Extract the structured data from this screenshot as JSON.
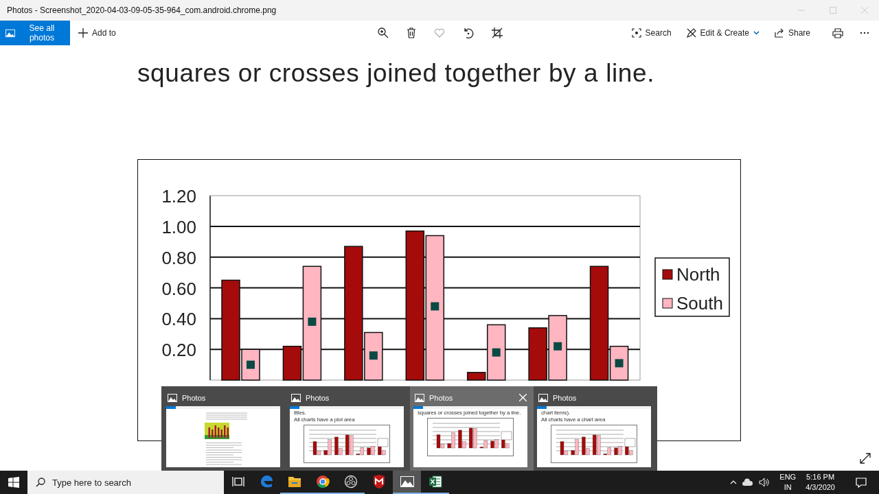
{
  "window": {
    "title": "Photos - Screenshot_2020-04-03-09-05-35-964_com.android.chrome.png"
  },
  "toolbar": {
    "see_all_photos": "See all photos",
    "add_to": "Add to",
    "favorite": false,
    "search": "Search",
    "edit_create": "Edit & Create",
    "share": "Share"
  },
  "image": {
    "heading": "squares or crosses joined together by a line.",
    "chart_data": {
      "type": "bar",
      "grid": true,
      "legend": "right",
      "ylim": [
        0,
        1.2
      ],
      "yticks": [
        {
          "value": 0.2,
          "label": "0.20"
        },
        {
          "value": 0.4,
          "label": "0.40"
        },
        {
          "value": 0.6,
          "label": "0.60"
        },
        {
          "value": 0.8,
          "label": "0.80"
        },
        {
          "value": 1.0,
          "label": "1.00"
        },
        {
          "value": 1.2,
          "label": "1.20"
        }
      ],
      "series": [
        {
          "name": "North",
          "color": "#a50b0b",
          "values": [
            0.65,
            0.22,
            0.87,
            0.97,
            0.05,
            0.34,
            0.74
          ]
        },
        {
          "name": "South",
          "color": "#ffb6c1",
          "values": [
            0.2,
            0.74,
            0.31,
            0.94,
            0.36,
            0.42,
            0.22
          ]
        },
        {
          "type": "scatter",
          "color": "#0a4a44",
          "values": [
            0.1,
            0.38,
            0.16,
            0.48,
            0.18,
            0.22,
            0.11
          ]
        }
      ]
    }
  },
  "task_previews": [
    {
      "title": "Photos",
      "selected": false,
      "kind": "document"
    },
    {
      "title": "Photos",
      "selected": false,
      "kind": "chart",
      "texts": [
        "titles.",
        "All charts have a plot area"
      ]
    },
    {
      "title": "Photos",
      "selected": true,
      "kind": "chart",
      "texts": [
        "squares or crosses joined together by a line."
      ]
    },
    {
      "title": "Photos",
      "selected": false,
      "kind": "chart",
      "texts": [
        "chart items).",
        "All charts have a chart area"
      ]
    }
  ],
  "taskbar": {
    "search_placeholder": "Type here to search",
    "apps": [
      {
        "kind": "taskview",
        "open": false,
        "selected": false
      },
      {
        "kind": "edge",
        "open": false,
        "selected": false
      },
      {
        "kind": "explorer",
        "open": true,
        "selected": false
      },
      {
        "kind": "chrome",
        "open": true,
        "selected": false
      },
      {
        "kind": "obs",
        "open": true,
        "selected": false
      },
      {
        "kind": "mcafee",
        "open": false,
        "selected": false
      },
      {
        "kind": "photos",
        "open": true,
        "selected": true
      },
      {
        "kind": "excel",
        "open": true,
        "selected": false
      }
    ],
    "language": "ENG",
    "region": "IN",
    "time": "5:16 PM",
    "date": "4/3/2020"
  }
}
